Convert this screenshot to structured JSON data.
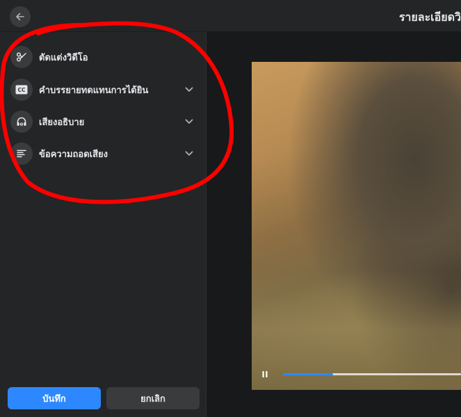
{
  "header": {
    "title": "รายละเอียดวิ",
    "back_icon": "arrow-left-icon"
  },
  "sidebar": {
    "items": [
      {
        "label": "ตัดแต่งวิดีโอ",
        "icon": "scissors-icon",
        "expandable": false
      },
      {
        "label": "คำบรรยายทดแทนการได้ยิน",
        "icon": "closed-captions-icon",
        "expandable": true
      },
      {
        "label": "เสียงอธิบาย",
        "icon": "headphones-icon",
        "expandable": true
      },
      {
        "label": "ข้อความถอดเสียง",
        "icon": "transcript-lines-icon",
        "expandable": true
      }
    ],
    "save_label": "บันทึก",
    "cancel_label": "ยกเลิก"
  },
  "video": {
    "progress": 0.28,
    "state": "playing"
  },
  "colors": {
    "accent": "#2d88ff",
    "panel": "#242526",
    "background": "#18191a",
    "annotation": "#ff0000"
  }
}
